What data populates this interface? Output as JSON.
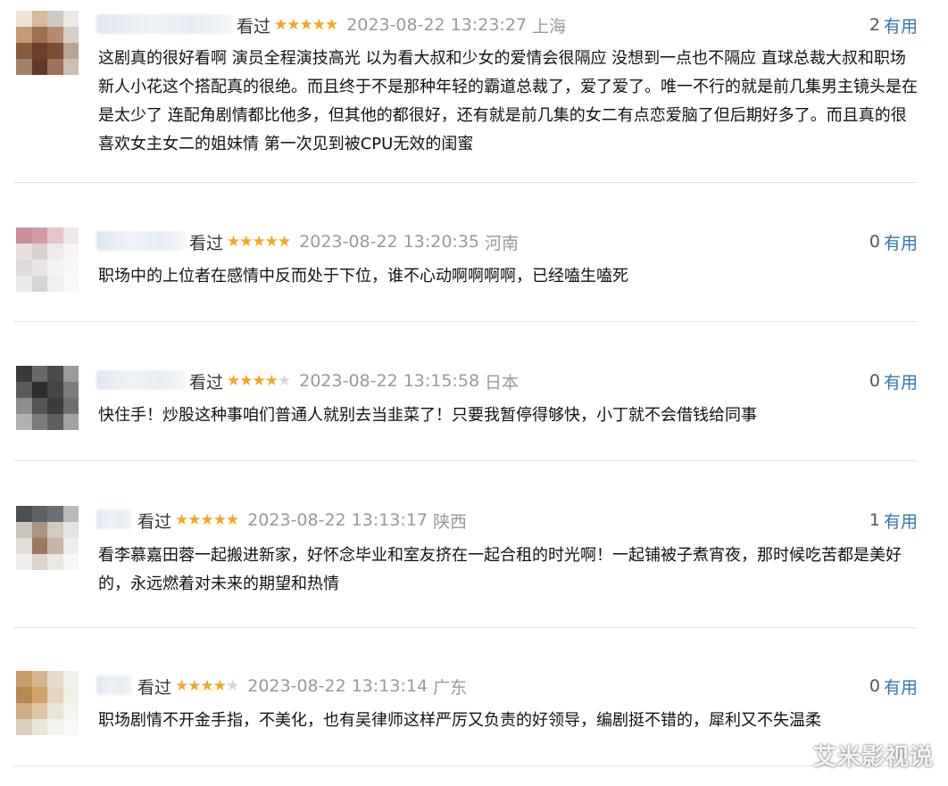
{
  "comments": [
    {
      "watched_label": "看过",
      "rating": 5,
      "time": "2023-08-22 13:23:27",
      "location": "上海",
      "votes": "2",
      "vote_label": "有用",
      "content": "这剧真的很好看啊 演员全程演技高光 以为看大叔和少女的爱情会很隔应 没想到一点也不隔应 直球总裁大叔和职场新人小花这个搭配真的很绝。而且终于不是那种年轻的霸道总裁了，爱了爱了。唯一不行的就是前几集男主镜头是在是太少了 连配角剧情都比他多，但其他的都很好，还有就是前几集的女二有点恋爱脑了但后期好多了。而且真的很喜欢女主女二的姐妹情 第一次见到被CPU无效的闺蜜"
    },
    {
      "watched_label": "看过",
      "rating": 5,
      "time": "2023-08-22 13:20:35",
      "location": "河南",
      "votes": "0",
      "vote_label": "有用",
      "content": "职场中的上位者在感情中反而处于下位，谁不心动啊啊啊啊，已经嗑生嗑死"
    },
    {
      "watched_label": "看过",
      "rating": 4,
      "time": "2023-08-22 13:15:58",
      "location": "日本",
      "votes": "0",
      "vote_label": "有用",
      "content": "快住手！炒股这种事咱们普通人就别去当韭菜了！只要我暂停得够快，小丁就不会借钱给同事"
    },
    {
      "watched_label": "看过",
      "rating": 5,
      "time": "2023-08-22 13:13:17",
      "location": "陕西",
      "votes": "1",
      "vote_label": "有用",
      "content": "看李慕嘉田蓉一起搬进新家，好怀念毕业和室友挤在一起合租的时光啊！一起铺被子煮宵夜，那时候吃苦都是美好的，永远燃着对未来的期望和热情"
    },
    {
      "watched_label": "看过",
      "rating": 4,
      "time": "2023-08-22 13:13:14",
      "location": "广东",
      "votes": "0",
      "vote_label": "有用",
      "content": "职场剧情不开金手指，不美化，也有吴律师这样严厉又负责的好领导，编剧挺不错的，犀利又不失温柔"
    }
  ],
  "watermark": "艾米影视说",
  "colors": {
    "star": "#f5a623",
    "star_off": "#d7d7d7",
    "link": "#3377aa",
    "meta": "#999999"
  }
}
